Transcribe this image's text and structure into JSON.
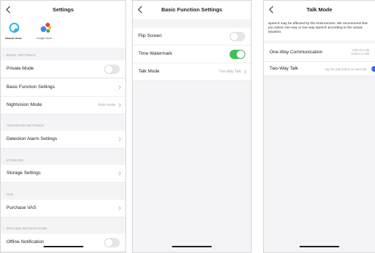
{
  "screen1": {
    "title": "Settings",
    "assistants": {
      "alexa_label": "amazon alexa",
      "google_label": "Google Home"
    },
    "sections": {
      "basic": "BASIC SETTINGS",
      "advanced": "ADVANCED SETTINGS",
      "storage": "STORAGE",
      "vas": "VAS",
      "offline": "OFFLINE NOTIFICATION"
    },
    "rows": {
      "private_mode": "Private Mode",
      "basic_function": "Basic Function Settings",
      "nightvision": "Nightvision Mode",
      "nightvision_value": "Auto mode",
      "detection_alarm": "Detection Alarm Settings",
      "storage_settings": "Storage Settings",
      "purchase_vas": "Purchase VAS",
      "offline_notification": "Offline Notification"
    },
    "toggles": {
      "private_mode": false,
      "offline_notification": false
    }
  },
  "screen2": {
    "title": "Basic Function Settings",
    "rows": {
      "flip_screen": "Flip Screen",
      "time_watermark": "Time Watermark",
      "talk_mode": "Talk Mode",
      "talk_mode_value": "Two-Way Talk"
    },
    "toggles": {
      "flip_screen": false,
      "time_watermark": true
    }
  },
  "screen3": {
    "title": "Talk Mode",
    "note": "Speech may be affected by the environment. We recommend that you select one-way or two-way speech according to the actual situation.",
    "options": {
      "one_way": "One-Way Communication",
      "one_way_hint_1": "Hold the talk",
      "one_way_hint_2": "button to talk",
      "two_way": "Two-Way Talk",
      "two_way_hint": "Tap the talk button to start talk"
    },
    "selected": "two_way"
  },
  "colors": {
    "toggle_on": "#3cc15a",
    "toggle_off": "#e5e5e8",
    "radio_selected": "#2f6fe0",
    "alexa_blue": "#2ab8e6"
  }
}
